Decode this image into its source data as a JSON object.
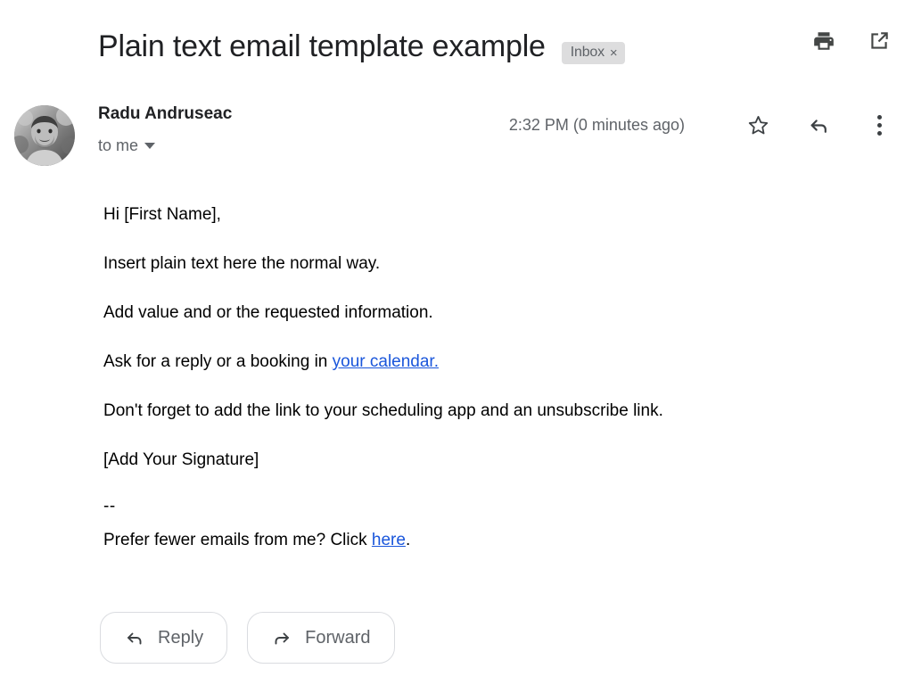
{
  "header": {
    "subject": "Plain text email template example",
    "label": "Inbox",
    "label_close": "×",
    "print_icon": "print-icon",
    "open_in_new_icon": "open-in-new-window-icon"
  },
  "sender": {
    "name": "Radu Andruseac",
    "recipient": "to me",
    "timestamp": "2:32 PM (0 minutes ago)",
    "avatar_alt": "sender-avatar-photo",
    "star_icon": "star-outline-icon",
    "reply_icon": "reply-arrow-icon",
    "more_icon": "more-options-icon"
  },
  "body": {
    "lines": [
      "Hi [First Name],",
      "Insert plain text here the normal way.",
      "Add value and or the requested information."
    ],
    "link_line": {
      "prefix": "Ask for a reply or a booking in ",
      "link_text": "your calendar.",
      "suffix": ""
    },
    "after_link_lines": [
      "Don't forget to add the link to your scheduling app and an unsubscribe link.",
      "[Add Your Signature]"
    ],
    "signature_separator": "--",
    "footer": {
      "prefix": "Prefer fewer emails from me? Click ",
      "link_text": "here",
      "suffix": "."
    }
  },
  "actions": {
    "reply_label": "Reply",
    "forward_label": "Forward"
  },
  "colors": {
    "link": "#1a56db",
    "subject_text": "#202124",
    "muted_text": "#5f6368",
    "chip_background": "#ddddde",
    "button_border": "#dadce0"
  }
}
